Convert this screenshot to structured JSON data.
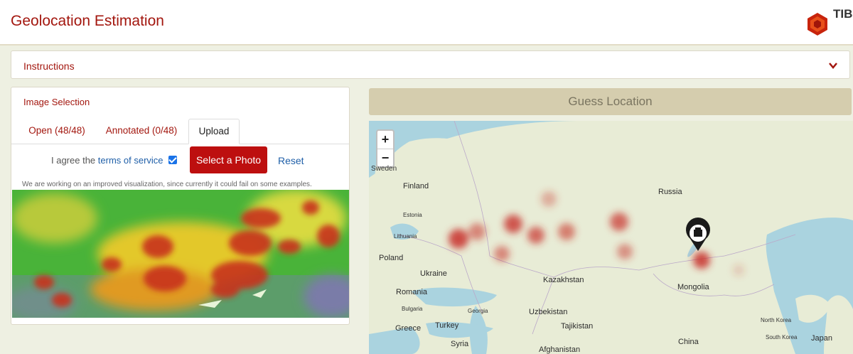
{
  "header": {
    "title": "Geolocation Estimation",
    "logo_text": "TIB"
  },
  "instructions": {
    "label": "Instructions"
  },
  "image_selection": {
    "title": "Image Selection",
    "tabs": [
      {
        "label": "Open (48/48)"
      },
      {
        "label": "Annotated (0/48)"
      },
      {
        "label": "Upload"
      }
    ],
    "active_tab": "Upload",
    "agree_prefix": "I agree the",
    "terms_link": "terms of service",
    "select_photo": "Select a Photo",
    "reset": "Reset",
    "notice": "We are working on an improved visualization, since currently it could fail on some examples."
  },
  "guess_button": "Guess Location",
  "map": {
    "zoom_in": "+",
    "zoom_out": "−",
    "labels": [
      "Sweden",
      "Finland",
      "Estonia",
      "Lithuania",
      "Poland",
      "Ukraine",
      "Romania",
      "Bulgaria",
      "Greece",
      "Turkey",
      "Georgia",
      "Syria",
      "Russia",
      "Kazakhstan",
      "Uzbekistan",
      "Tajikistan",
      "Afghanistan",
      "Mongolia",
      "China",
      "North Korea",
      "South Korea",
      "Japan"
    ]
  },
  "colors": {
    "accent": "#a3170f",
    "button": "#bd0f0f",
    "link": "#1f5fa8",
    "guess_bg": "#d5cdae"
  }
}
